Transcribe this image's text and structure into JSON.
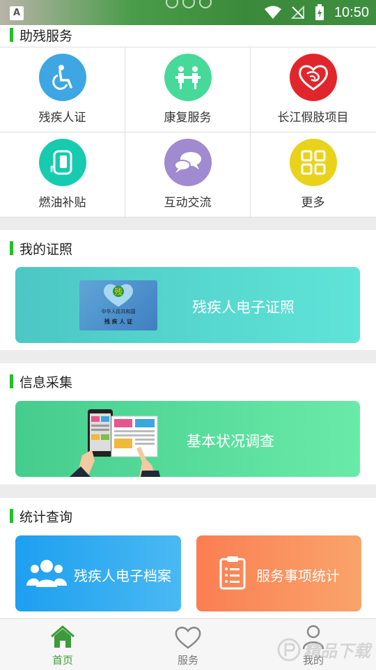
{
  "status_bar": {
    "time": "10:50",
    "left_icon": "A"
  },
  "sections": {
    "services": {
      "title": "助残服务",
      "items": [
        {
          "label": "残疾人证",
          "icon": "wheelchair-icon",
          "color": "#3ea6e3"
        },
        {
          "label": "康复服务",
          "icon": "rehab-icon",
          "color": "#47d99a"
        },
        {
          "label": "长江假肢项目",
          "icon": "heart-hand-icon",
          "color": "#e1262b"
        },
        {
          "label": "燃油补贴",
          "icon": "fuel-pump-icon",
          "color": "#16cbb0"
        },
        {
          "label": "互动交流",
          "icon": "chat-bubbles-icon",
          "color": "#a08ad0"
        },
        {
          "label": "更多",
          "icon": "grid-more-icon",
          "color": "#e9d21a"
        }
      ]
    },
    "license": {
      "title": "我的证照",
      "banner_text": "残疾人电子证照",
      "card_line1": "中华人民共和国",
      "card_line2": "残 疾 人 证"
    },
    "info": {
      "title": "信息采集",
      "banner_text": "基本状况调查"
    },
    "stats": {
      "title": "统计查询",
      "left_text": "残疾人电子档案",
      "right_text": "服务事项统计"
    }
  },
  "tabs": [
    {
      "label": "首页",
      "icon": "home-icon",
      "active": true
    },
    {
      "label": "服务",
      "icon": "heart-icon",
      "active": false
    },
    {
      "label": "我的",
      "icon": "user-icon",
      "active": false
    }
  ],
  "watermark": {
    "text": "精品下载"
  }
}
